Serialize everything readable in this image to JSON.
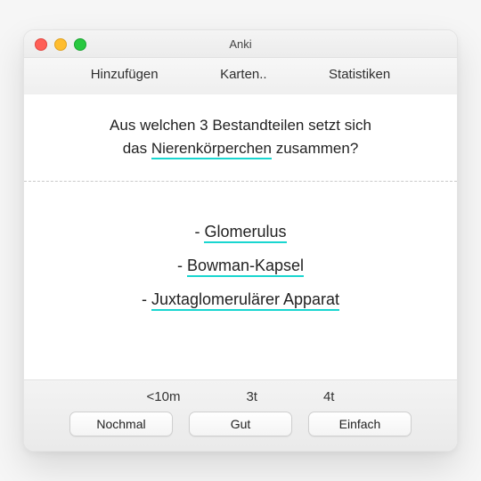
{
  "window": {
    "title": "Anki"
  },
  "toolbar": {
    "add": "Hinzufügen",
    "cards": "Karten..",
    "stats": "Statistiken"
  },
  "card": {
    "question_pre": "Aus welchen 3 Bestandteilen setzt sich",
    "question_pre2": "das ",
    "question_keyword": "Nierenkörperchen",
    "question_post": " zusammen?",
    "answers": {
      "a1": "Glomerulus",
      "a2": "Bowman-Kapsel",
      "a3": "Juxtaglomerulärer Apparat"
    },
    "bullet": "- "
  },
  "review": {
    "intervals": {
      "again": "<10m",
      "good": "3t",
      "easy": "4t"
    },
    "buttons": {
      "again": "Nochmal",
      "good": "Gut",
      "easy": "Einfach"
    }
  }
}
